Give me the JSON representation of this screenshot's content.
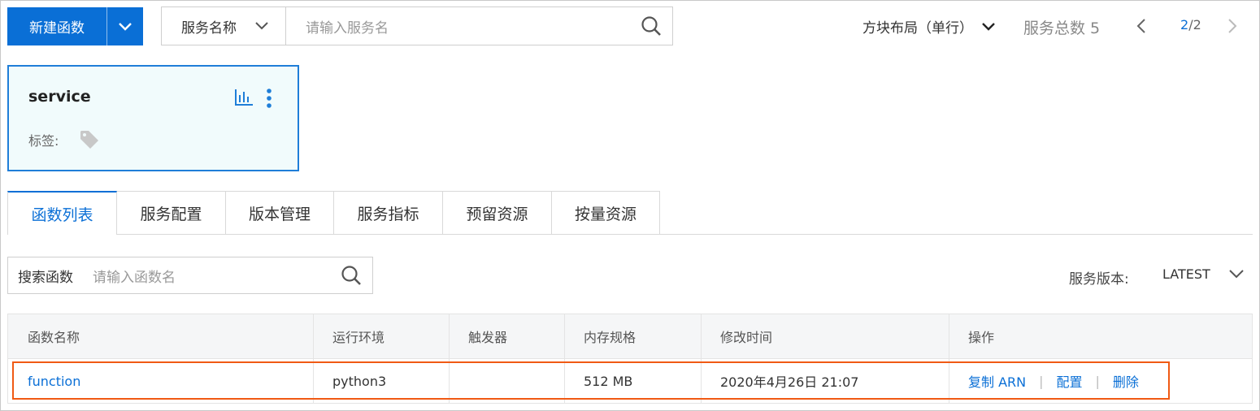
{
  "toolbar": {
    "new_function_label": "新建函数",
    "search_type": "服务名称",
    "search_placeholder": "请输入服务名",
    "layout_label": "方块布局（单行）",
    "total_services": "服务总数 5",
    "page_current": "2",
    "page_total": "/2"
  },
  "service_card": {
    "name": "service",
    "tags_label": "标签:"
  },
  "tabs": [
    "函数列表",
    "服务配置",
    "版本管理",
    "服务指标",
    "预留资源",
    "按量资源"
  ],
  "function_search": {
    "label": "搜索函数",
    "placeholder": "请输入函数名"
  },
  "service_version": {
    "label": "服务版本:",
    "value": "LATEST"
  },
  "table": {
    "headers": [
      "函数名称",
      "运行环境",
      "触发器",
      "内存规格",
      "修改时间",
      "操作"
    ],
    "rows": [
      {
        "name": "function",
        "runtime": "python3",
        "trigger": "",
        "memory": "512 MB",
        "modified": "2020年4月26日 21:07",
        "actions": [
          "复制 ARN",
          "配置",
          "删除"
        ],
        "action_separator": "|"
      }
    ]
  },
  "colors": {
    "primary": "#0a6fd6",
    "highlight": "#f05a14",
    "card_bg": "#f1fbfc"
  }
}
